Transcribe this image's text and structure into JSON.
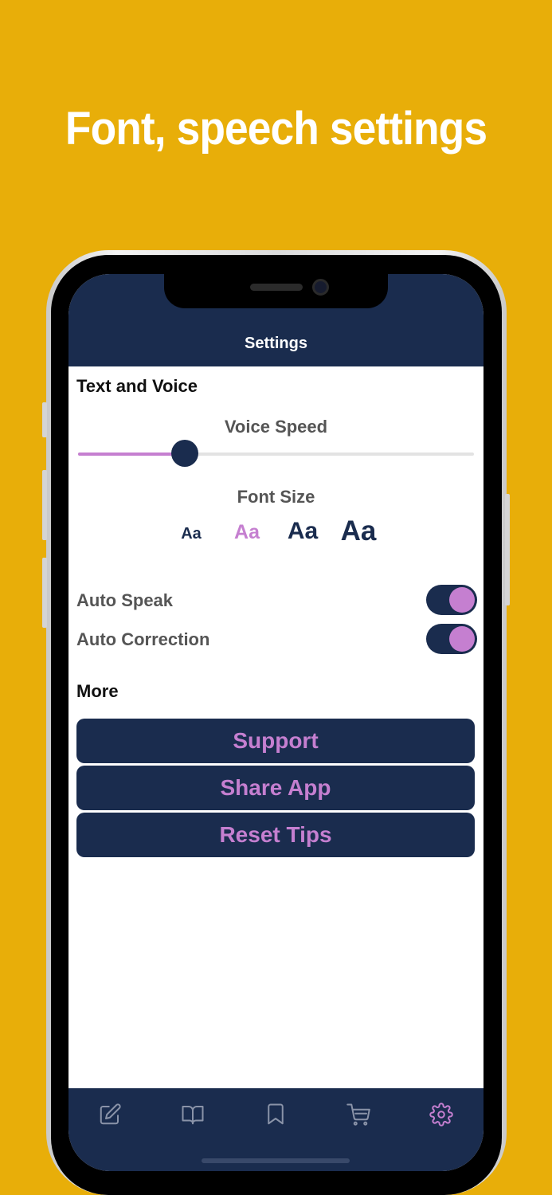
{
  "headline": "Font, speech settings",
  "nav": {
    "title": "Settings"
  },
  "text_voice": {
    "title": "Text and Voice",
    "voice_speed_label": "Voice Speed",
    "voice_speed_value": 0.27,
    "font_size_label": "Font Size",
    "font_options": [
      {
        "label": "Aa",
        "selected": false
      },
      {
        "label": "Aa",
        "selected": true
      },
      {
        "label": "Aa",
        "selected": false
      },
      {
        "label": "Aa",
        "selected": false
      }
    ]
  },
  "toggles": [
    {
      "label": "Auto Speak",
      "on": true
    },
    {
      "label": "Auto Correction",
      "on": true
    }
  ],
  "more": {
    "title": "More",
    "buttons": [
      "Support",
      "Share App",
      "Reset Tips"
    ]
  },
  "tabbar": {
    "items": [
      {
        "icon": "edit-icon",
        "active": false
      },
      {
        "icon": "book-icon",
        "active": false
      },
      {
        "icon": "bookmark-icon",
        "active": false
      },
      {
        "icon": "cart-icon",
        "active": false
      },
      {
        "icon": "gear-icon",
        "active": true
      }
    ]
  },
  "colors": {
    "background": "#E8AE09",
    "navy": "#1A2C4E",
    "accent": "#C57FD0",
    "tab_inactive": "#8a93a8"
  }
}
